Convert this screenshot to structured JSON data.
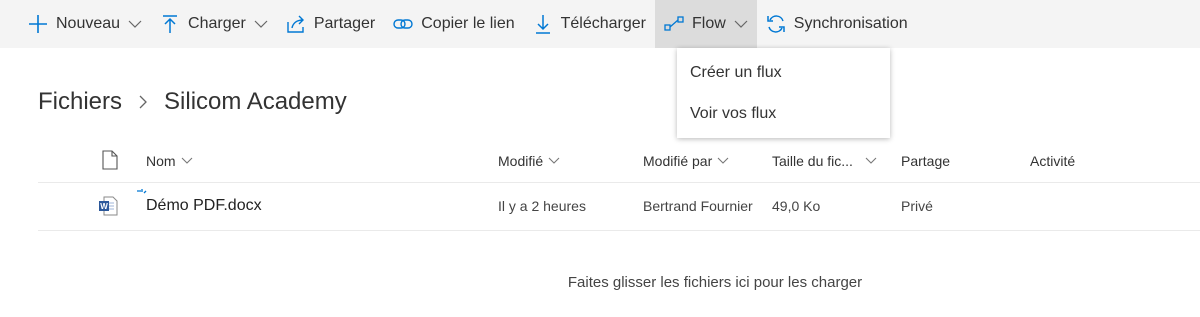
{
  "toolbar": {
    "items": [
      {
        "label": "Nouveau",
        "icon": "plus-icon",
        "has_dropdown": true
      },
      {
        "label": "Charger",
        "icon": "upload-icon",
        "has_dropdown": true
      },
      {
        "label": "Partager",
        "icon": "share-icon",
        "has_dropdown": false
      },
      {
        "label": "Copier le lien",
        "icon": "link-icon",
        "has_dropdown": false
      },
      {
        "label": "Télécharger",
        "icon": "download-icon",
        "has_dropdown": false
      },
      {
        "label": "Flow",
        "icon": "flow-icon",
        "has_dropdown": true,
        "active": true
      },
      {
        "label": "Synchronisation",
        "icon": "sync-icon",
        "has_dropdown": false
      }
    ]
  },
  "flow_menu": {
    "items": [
      "Créer un flux",
      "Voir vos flux"
    ]
  },
  "breadcrumb": {
    "root": "Fichiers",
    "current": "Silicom Academy"
  },
  "file_list": {
    "columns": {
      "name": "Nom",
      "modified": "Modifié",
      "modified_by": "Modifié par",
      "size": "Taille du fic...",
      "sharing": "Partage",
      "activity": "Activité"
    },
    "rows": [
      {
        "name": "Démo PDF.docx",
        "modified": "Il y a 2 heures",
        "modified_by": "Bertrand Fournier",
        "size": "49,0 Ko",
        "sharing": "Privé",
        "activity": ""
      }
    ]
  },
  "drop_hint": "Faites glisser les fichiers ici pour les charger",
  "colors": {
    "accent": "#0078d4",
    "toolbar_bg": "#f4f4f4",
    "toolbar_active_bg": "#dcdcdc",
    "word_blue": "#2b579a"
  }
}
